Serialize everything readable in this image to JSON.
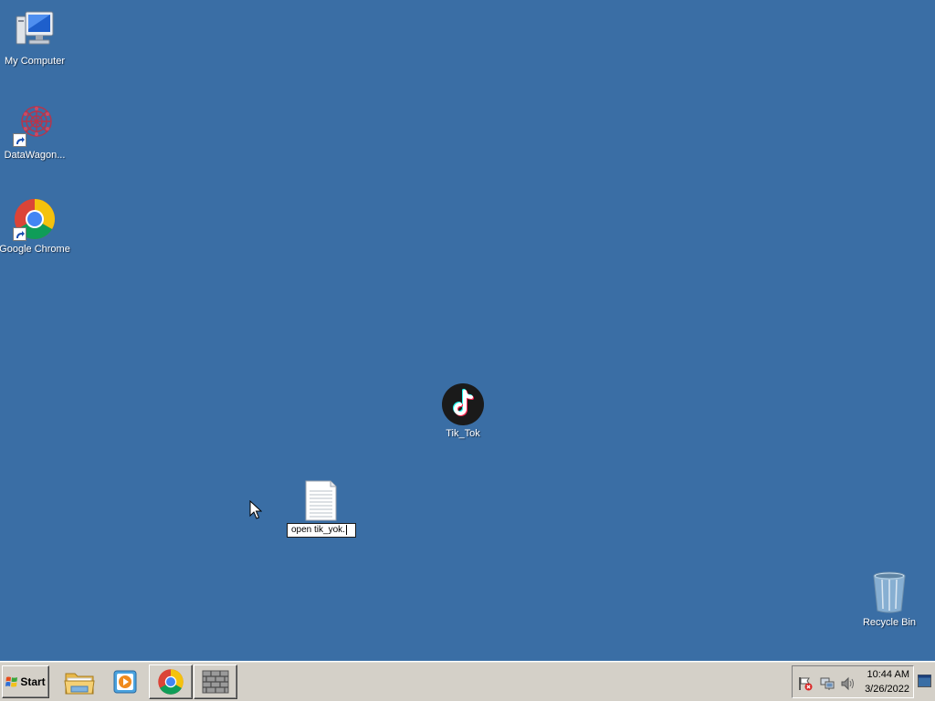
{
  "desktop": {
    "icons": {
      "my_computer": "My Computer",
      "datawagon": "DataWagon...",
      "chrome": "Google Chrome",
      "tiktok": "Tik_Tok",
      "recycle_bin": "Recycle Bin"
    },
    "rename_value": "open tik_yok."
  },
  "taskbar": {
    "start_label": "Start",
    "clock_time": "10:44 AM",
    "clock_date": "3/26/2022"
  },
  "colors": {
    "desktop_background": "#3a6ea5",
    "taskbar": "#d4d0c8"
  }
}
